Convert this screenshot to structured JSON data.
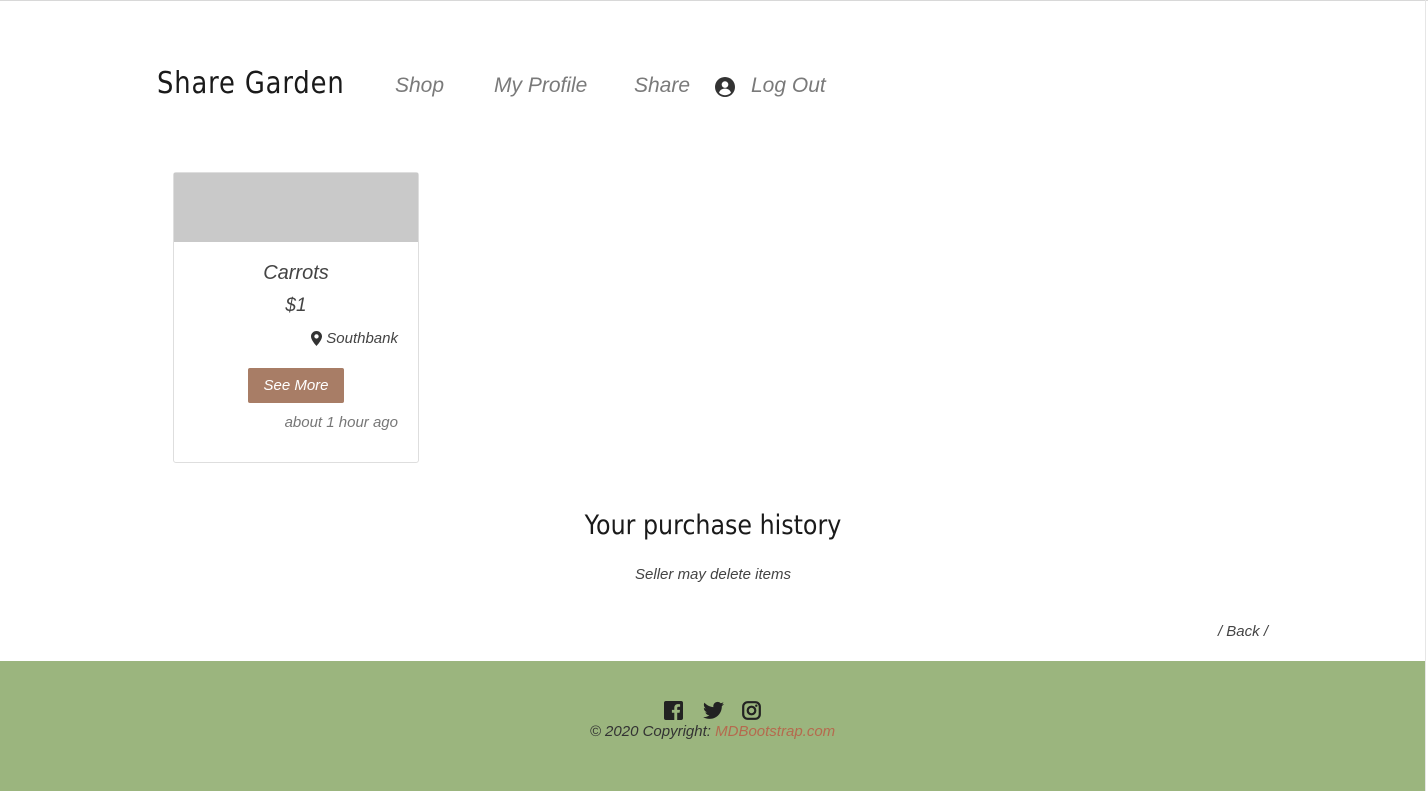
{
  "header": {
    "brand": "Share Garden",
    "nav": {
      "shop": "Shop",
      "my_profile": "My Profile",
      "share": "Share",
      "logout": "Log Out"
    }
  },
  "cards": [
    {
      "title": "Carrots",
      "price": "$1",
      "location": "Southbank",
      "button_label": "See More",
      "time_posted": "about 1 hour ago"
    }
  ],
  "history": {
    "title": "Your purchase history",
    "subtitle": "Seller may delete items"
  },
  "back_link": "/ Back /",
  "footer": {
    "social_icons": [
      "facebook-icon",
      "twitter-icon",
      "instagram-icon"
    ],
    "copyright_text": "© 2020 Copyright:",
    "copyright_link": "MDBootstrap.com"
  },
  "colors": {
    "footer_bg": "#9bb57e",
    "button_bg": "#a87d66",
    "link_accent": "#b56a4e",
    "image_placeholder": "#c9c9c9"
  }
}
